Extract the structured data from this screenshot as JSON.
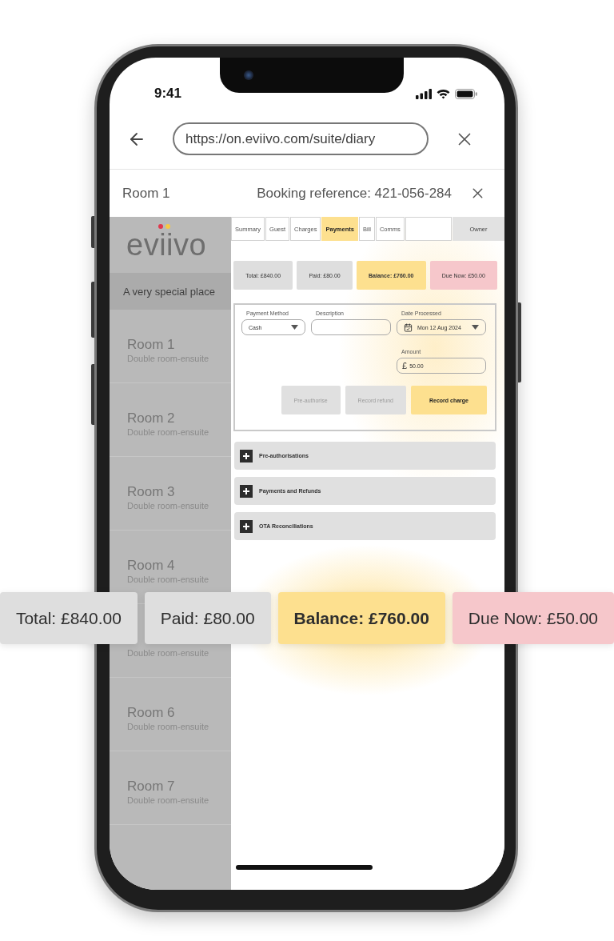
{
  "status_bar": {
    "time": "9:41"
  },
  "browser": {
    "url": "https://on.eviivo.com/suite/diary"
  },
  "booking_header": {
    "room": "Room 1",
    "reference": "Booking reference: 421-056-284"
  },
  "sidebar": {
    "logo": "eviivo",
    "tagline": "A very special place",
    "rooms": [
      {
        "title": "Room 1",
        "subtitle": "Double room-ensuite"
      },
      {
        "title": "Room 2",
        "subtitle": "Double room-ensuite"
      },
      {
        "title": "Room 3",
        "subtitle": "Double room-ensuite"
      },
      {
        "title": "Room 4",
        "subtitle": "Double room-ensuite"
      },
      {
        "subtitle": "Double room-ensuite"
      },
      {
        "title": "Room 6",
        "subtitle": "Double room-ensuite"
      },
      {
        "title": "Room 7",
        "subtitle": "Double room-ensuite"
      }
    ]
  },
  "tabs": [
    {
      "label": "Summary",
      "selected": false
    },
    {
      "label": "Guest",
      "selected": false
    },
    {
      "label": "Charges",
      "selected": false
    },
    {
      "label": "Payments",
      "selected": true
    },
    {
      "label": "Bill",
      "selected": false
    },
    {
      "label": "Comms",
      "selected": false
    },
    {
      "selected": false
    }
  ],
  "owner_tab": {
    "label": "Owner"
  },
  "summary": [
    {
      "label": "Total: £840.00",
      "color": "#dedede",
      "emphasized": false
    },
    {
      "label": "Paid: £80.00",
      "color": "#dedede",
      "emphasized": false
    },
    {
      "label": "Balance: £760.00",
      "color": "#fde08f",
      "emphasized": true
    },
    {
      "label": "Due Now: £50.00",
      "color": "#f6c7cb",
      "emphasized": false
    }
  ],
  "payment_form": {
    "fields": [
      {
        "kind": "select",
        "label": "Payment Method",
        "value": "Cash"
      },
      {
        "kind": "text",
        "label": "Description"
      },
      {
        "kind": "date",
        "label": "Date Processed",
        "value": "Mon 12 Aug 2024"
      },
      {
        "kind": "amount",
        "label": "Amount",
        "currency": "£",
        "value": "50.00"
      }
    ],
    "buttons": [
      {
        "label": "Pre-authorise",
        "disabled": true
      },
      {
        "label": "Record refund",
        "disabled": true
      },
      {
        "label": "Record charge",
        "disabled": false
      }
    ]
  },
  "sections": [
    {
      "label": "Pre-authorisations",
      "expanded": false
    },
    {
      "label": "Payments and Refunds",
      "expanded": false
    },
    {
      "label": "OTA Reconciliations",
      "expanded": false
    }
  ],
  "callout": [
    {
      "label": "Total: £840.00",
      "color": "#dedede",
      "emphasized": false
    },
    {
      "label": "Paid: £80.00",
      "color": "#dedede",
      "emphasized": false
    },
    {
      "label": "Balance: £760.00",
      "color": "#fde08f",
      "emphasized": true
    },
    {
      "label": "Due Now: £50.00",
      "color": "#f6c7cb",
      "emphasized": false
    }
  ]
}
